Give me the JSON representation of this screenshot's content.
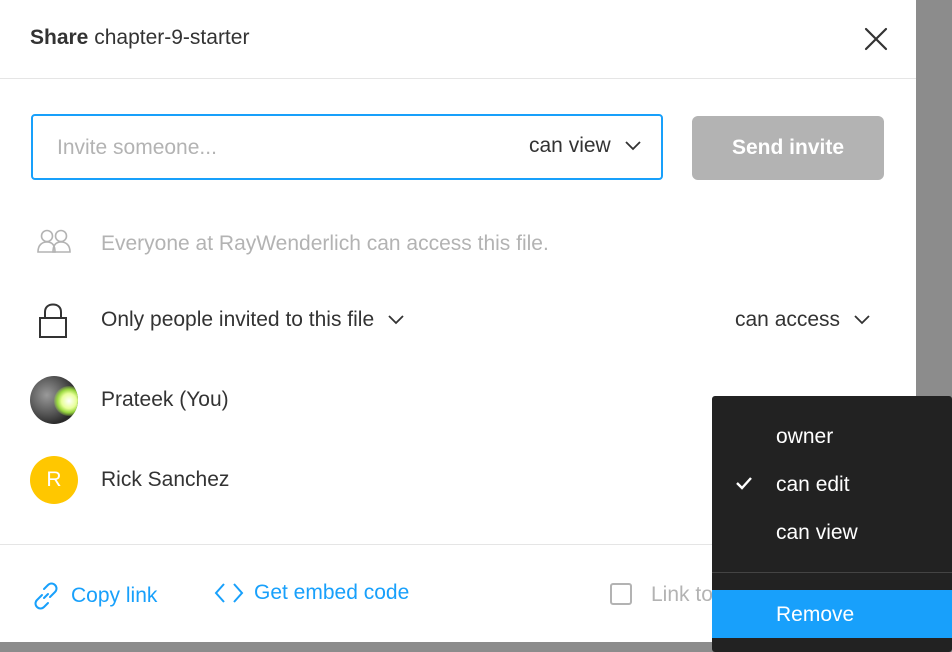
{
  "dialog": {
    "title_bold": "Share",
    "title_name": "chapter-9-starter"
  },
  "invite": {
    "placeholder": "Invite someone...",
    "value": "",
    "permission": "can view",
    "send_label": "Send invite"
  },
  "everyone_text": "Everyone at RayWenderlich can access this file.",
  "visibility": {
    "label": "Only people invited to this file",
    "access_label": "can access"
  },
  "people": [
    {
      "name": "Prateek (You)",
      "avatar": "photo"
    },
    {
      "name": "Rick Sanchez",
      "avatar_initial": "R",
      "avatar_color": "#ffc700"
    }
  ],
  "footer": {
    "copy_link": "Copy link",
    "embed": "Get embed code",
    "link_text": "Link to"
  },
  "role_menu": {
    "items": [
      {
        "label": "owner",
        "checked": false
      },
      {
        "label": "can edit",
        "checked": true
      },
      {
        "label": "can view",
        "checked": false
      }
    ],
    "remove_label": "Remove"
  },
  "colors": {
    "accent": "#18a0fb",
    "disabled": "#b3b3b3",
    "menu_bg": "#222222",
    "avatar_yellow": "#ffc700"
  }
}
